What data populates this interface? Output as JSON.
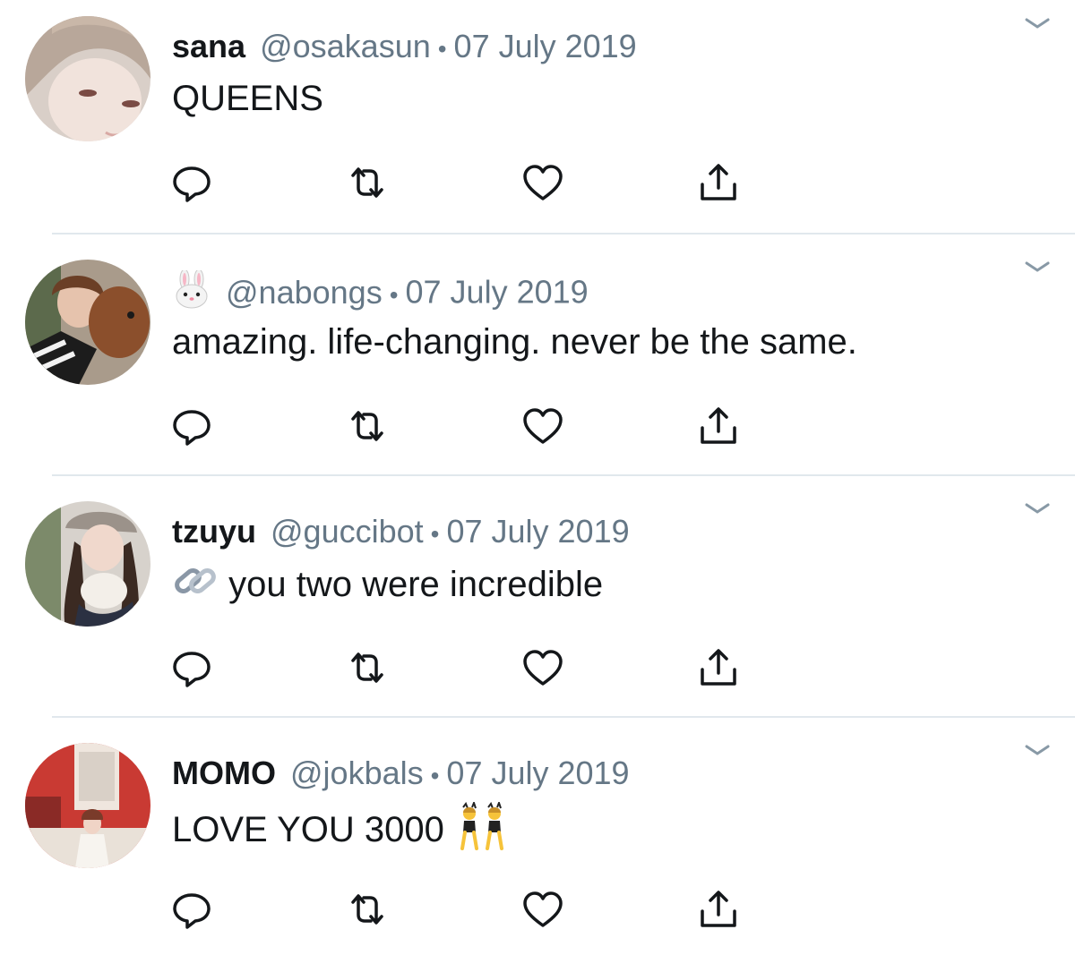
{
  "colors": {
    "text": "#14171a",
    "secondary": "#657786",
    "divider": "#e1e8ed",
    "icon": "#14171a"
  },
  "separator": "•",
  "tweets": [
    {
      "name": "sana",
      "handle": "@osakasun",
      "date": "07 July 2019",
      "text": "QUEENS",
      "name_icon": null,
      "text_icon": null,
      "avatar": "avatar-sana"
    },
    {
      "name": "",
      "handle": "@nabongs",
      "date": "07 July 2019",
      "text": "amazing. life-changing. never be the same.",
      "name_icon": "rabbit-face-emoji",
      "text_icon": null,
      "avatar": "avatar-nabongs"
    },
    {
      "name": "tzuyu",
      "handle": "@guccibot",
      "date": "07 July 2019",
      "text": "you two were incredible",
      "name_icon": null,
      "text_icon": "link-emoji",
      "avatar": "avatar-tzuyu"
    },
    {
      "name": "MOMO",
      "handle": "@jokbals",
      "date": "07 July 2019",
      "text": "LOVE YOU 3000",
      "name_icon": null,
      "text_icon": "dancers-emoji",
      "avatar": "avatar-momo"
    }
  ],
  "actions": [
    "reply-icon",
    "retweet-icon",
    "like-icon",
    "share-icon"
  ]
}
